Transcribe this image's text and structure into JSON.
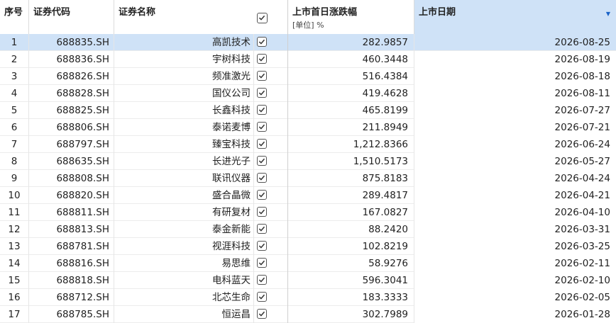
{
  "table": {
    "headers": {
      "index": "序号",
      "code": "证券代码",
      "name": "证券名称",
      "change": "上市首日涨跌幅",
      "change_unit": "[单位] %",
      "date": "上市日期"
    },
    "rows": [
      {
        "index": "1",
        "code": "688835.SH",
        "name": "高凯技术",
        "change": "282.9857",
        "date": "2026-08-25"
      },
      {
        "index": "2",
        "code": "688836.SH",
        "name": "宇树科技",
        "change": "460.3448",
        "date": "2026-08-19"
      },
      {
        "index": "3",
        "code": "688826.SH",
        "name": "频准激光",
        "change": "516.4384",
        "date": "2026-08-18"
      },
      {
        "index": "4",
        "code": "688828.SH",
        "name": "国仪公司",
        "change": "419.4628",
        "date": "2026-08-11"
      },
      {
        "index": "5",
        "code": "688825.SH",
        "name": "长鑫科技",
        "change": "465.8199",
        "date": "2026-07-27"
      },
      {
        "index": "6",
        "code": "688806.SH",
        "name": "泰诺麦博",
        "change": "211.8949",
        "date": "2026-07-21"
      },
      {
        "index": "7",
        "code": "688797.SH",
        "name": "臻宝科技",
        "change": "1,212.8366",
        "date": "2026-06-24"
      },
      {
        "index": "8",
        "code": "688635.SH",
        "name": "长进光子",
        "change": "1,510.5173",
        "date": "2026-05-27"
      },
      {
        "index": "9",
        "code": "688808.SH",
        "name": "联讯仪器",
        "change": "875.8183",
        "date": "2026-04-24"
      },
      {
        "index": "10",
        "code": "688820.SH",
        "name": "盛合晶微",
        "change": "289.4817",
        "date": "2026-04-21"
      },
      {
        "index": "11",
        "code": "688811.SH",
        "name": "有研复材",
        "change": "167.0827",
        "date": "2026-04-10"
      },
      {
        "index": "12",
        "code": "688813.SH",
        "name": "泰金新能",
        "change": "88.2420",
        "date": "2026-03-31"
      },
      {
        "index": "13",
        "code": "688781.SH",
        "name": "视涯科技",
        "change": "102.8219",
        "date": "2026-03-25"
      },
      {
        "index": "14",
        "code": "688816.SH",
        "name": "易思维",
        "change": "58.9276",
        "date": "2026-02-11"
      },
      {
        "index": "15",
        "code": "688818.SH",
        "name": "电科蓝天",
        "change": "596.3041",
        "date": "2026-02-10"
      },
      {
        "index": "16",
        "code": "688712.SH",
        "name": "北芯生命",
        "change": "183.3333",
        "date": "2026-02-05"
      },
      {
        "index": "17",
        "code": "688785.SH",
        "name": "恒运昌",
        "change": "302.7989",
        "date": "2026-01-28"
      }
    ],
    "selected_row": 0,
    "all_checked": true,
    "sort_icon": "sort-descending-icon"
  },
  "colors": {
    "selection": "#cfe2f7",
    "sort_arrow": "#1a63c8"
  }
}
